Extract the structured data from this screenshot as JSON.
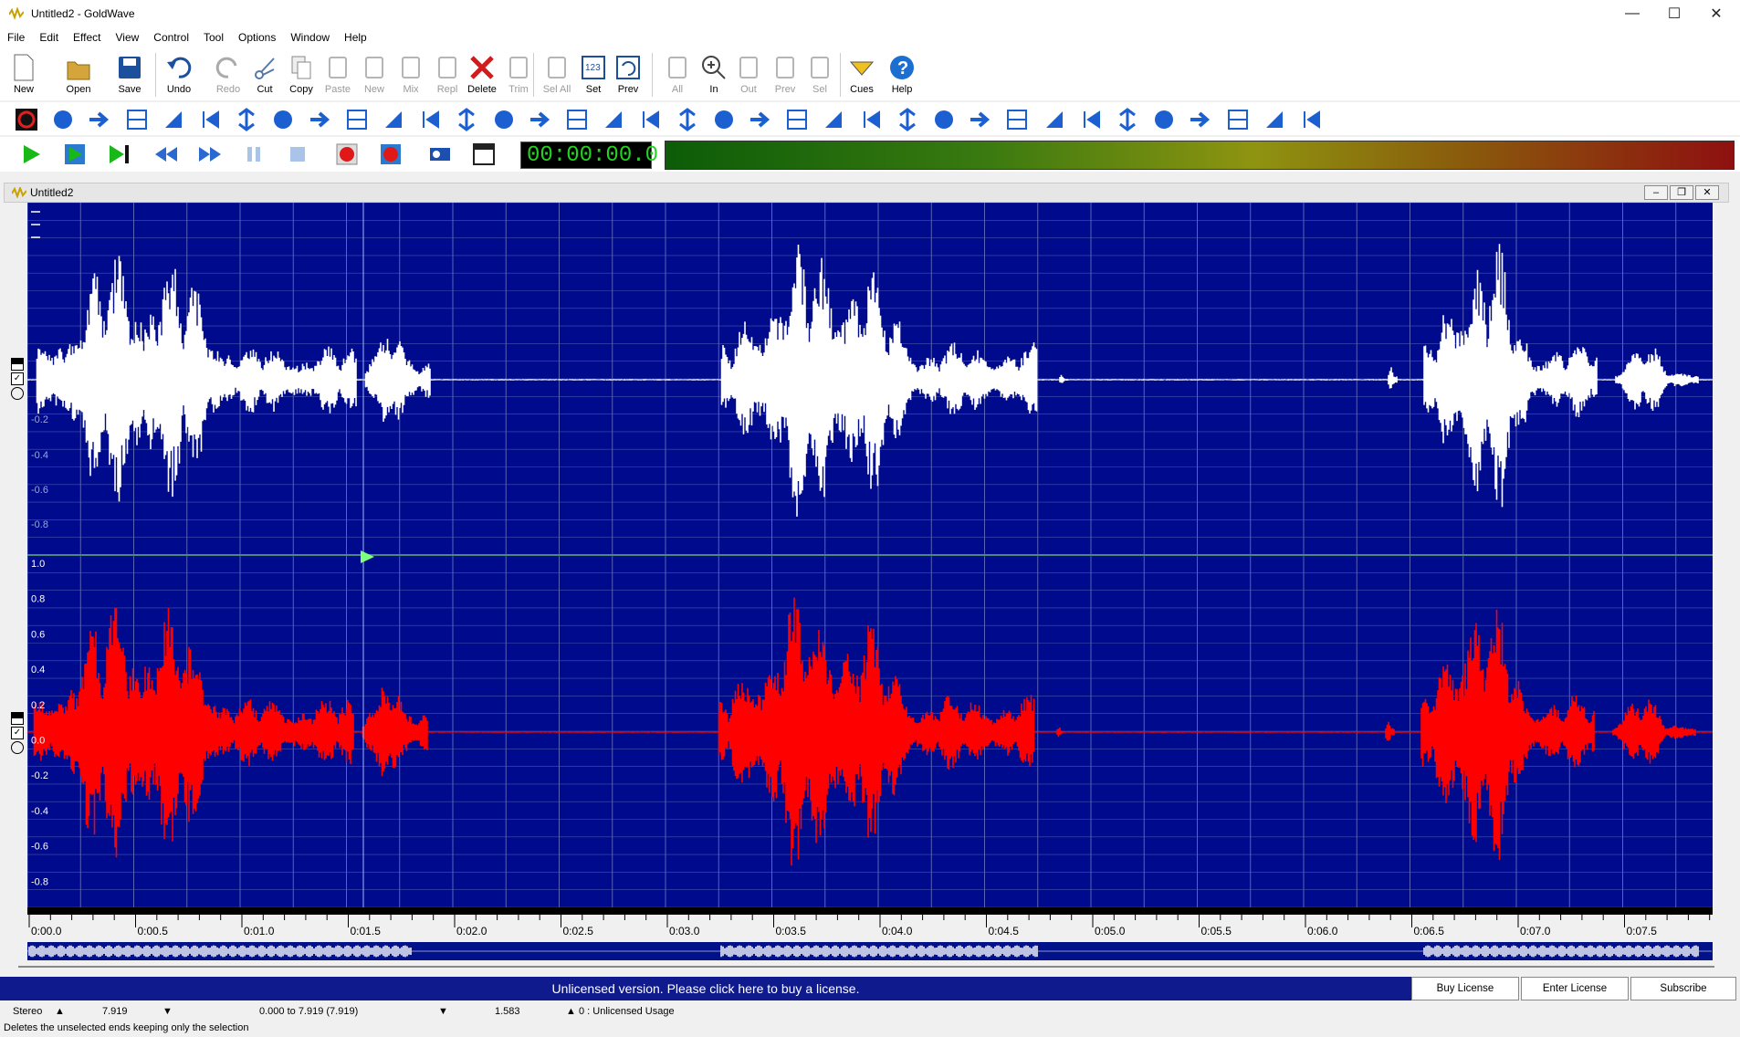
{
  "window": {
    "title": "Untitled2 - GoldWave",
    "minimize": "—",
    "maximize": "☐",
    "close": "✕"
  },
  "menu": [
    "File",
    "Edit",
    "Effect",
    "View",
    "Control",
    "Tool",
    "Options",
    "Window",
    "Help"
  ],
  "toolbar1": [
    {
      "label": "New",
      "icon": "new-file-icon",
      "enabled": true
    },
    {
      "label": "Open",
      "icon": "open-folder-icon",
      "enabled": true
    },
    {
      "label": "Save",
      "icon": "save-disk-icon",
      "enabled": true
    },
    {
      "label": "Undo",
      "icon": "undo-icon",
      "enabled": true
    },
    {
      "label": "Redo",
      "icon": "redo-icon",
      "enabled": false
    },
    {
      "label": "Cut",
      "icon": "scissors-icon",
      "enabled": true
    },
    {
      "label": "Copy",
      "icon": "copy-icon",
      "enabled": true
    },
    {
      "label": "Paste",
      "icon": "paste-icon",
      "enabled": false
    },
    {
      "label": "New",
      "icon": "paste-new-icon",
      "enabled": false
    },
    {
      "label": "Mix",
      "icon": "mix-icon",
      "enabled": false
    },
    {
      "label": "Repl",
      "icon": "replace-icon",
      "enabled": false
    },
    {
      "label": "Delete",
      "icon": "delete-x-icon",
      "enabled": true
    },
    {
      "label": "Trim",
      "icon": "trim-icon",
      "enabled": false
    },
    {
      "label": "Sel All",
      "icon": "select-all-icon",
      "enabled": false
    },
    {
      "label": "Set",
      "icon": "set-selection-icon",
      "enabled": true
    },
    {
      "label": "Prev",
      "icon": "previous-selection-icon",
      "enabled": true
    },
    {
      "label": "All",
      "icon": "zoom-all-icon",
      "enabled": false
    },
    {
      "label": "In",
      "icon": "zoom-in-icon",
      "enabled": true
    },
    {
      "label": "Out",
      "icon": "zoom-out-icon",
      "enabled": false
    },
    {
      "label": "Prev",
      "icon": "zoom-previous-icon",
      "enabled": false
    },
    {
      "label": "Sel",
      "icon": "zoom-selection-icon",
      "enabled": false
    },
    {
      "label": "Cues",
      "icon": "cues-icon",
      "enabled": true
    },
    {
      "label": "Help",
      "icon": "help-icon",
      "enabled": true
    }
  ],
  "transport": {
    "time": "00:00:00.0"
  },
  "document": {
    "title": "Untitled2"
  },
  "waveform": {
    "top_channel_labels": [
      "-0.2",
      "-0.4",
      "-0.6",
      "-0.8"
    ],
    "bottom_channel_labels": [
      "1.0",
      "0.8",
      "0.6",
      "0.4",
      "0.2",
      "0.0",
      "-0.2",
      "-0.4",
      "-0.6",
      "-0.8"
    ],
    "colors": {
      "background": "#000a8c",
      "left_channel": "#ffffff",
      "right_channel": "#ff0000",
      "grid": "#5a64b4",
      "playhead": "#7cff7c"
    }
  },
  "timeline": [
    "0:00.0",
    "0:00.5",
    "0:01.0",
    "0:01.5",
    "0:02.0",
    "0:02.5",
    "0:03.0",
    "0:03.5",
    "0:04.0",
    "0:04.5",
    "0:05.0",
    "0:05.5",
    "0:06.0",
    "0:06.5",
    "0:07.0",
    "0:07.5"
  ],
  "license": {
    "message": "Unlicensed version. Please click here to buy a license.",
    "buy": "Buy License",
    "enter": "Enter License",
    "subscribe": "Subscribe"
  },
  "status": {
    "channels": "Stereo",
    "length": "7.919",
    "selection": "0.000 to 7.919 (7.919)",
    "position": "1.583",
    "usage": "0 : Unlicensed Usage",
    "hint": "Deletes the unselected ends keeping only the selection"
  }
}
